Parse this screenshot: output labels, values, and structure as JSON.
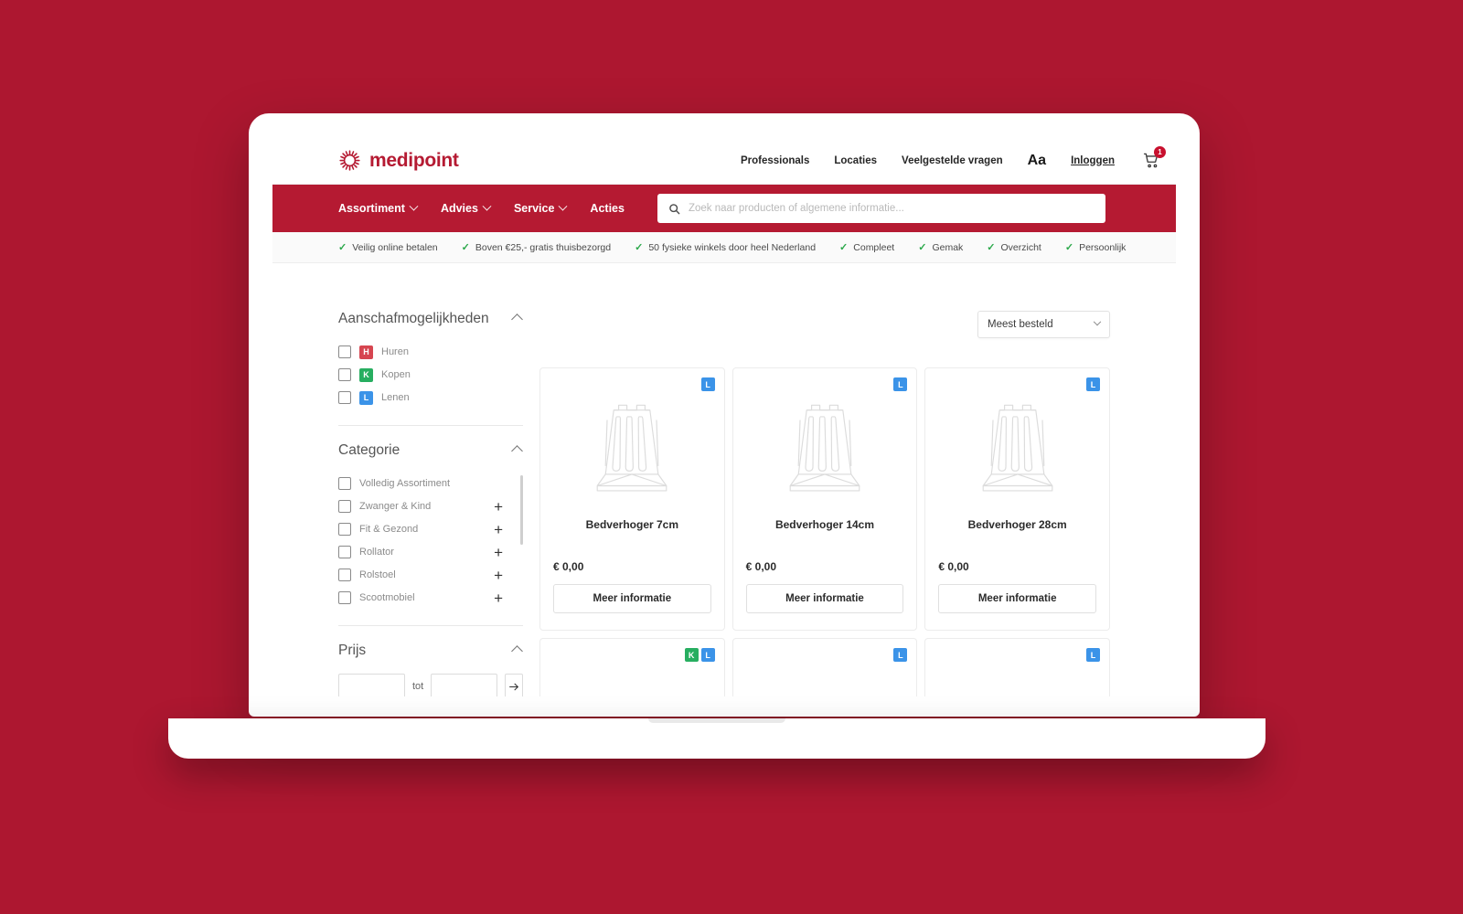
{
  "brand": {
    "name": "medipoint",
    "red": "#B51A32",
    "page_background": "#AD1730"
  },
  "header": {
    "links": [
      {
        "label": "Professionals"
      },
      {
        "label": "Locaties"
      },
      {
        "label": "Veelgestelde vragen"
      }
    ],
    "font_size_toggle": "Aa",
    "login_label": "Inloggen",
    "cart_count": "1"
  },
  "main_nav": {
    "items": [
      {
        "label": "Assortiment",
        "has_dropdown": true
      },
      {
        "label": "Advies",
        "has_dropdown": true
      },
      {
        "label": "Service",
        "has_dropdown": true
      },
      {
        "label": "Acties",
        "has_dropdown": false
      }
    ],
    "search": {
      "placeholder": "Zoek naar producten of algemene informatie...",
      "value": ""
    }
  },
  "usp_bar": {
    "items": [
      {
        "label": "Veilig online betalen"
      },
      {
        "label": "Boven €25,- gratis thuisbezorgd"
      },
      {
        "label": "50 fysieke winkels door heel Nederland"
      },
      {
        "label": "Compleet"
      },
      {
        "label": "Gemak"
      },
      {
        "label": "Overzicht"
      },
      {
        "label": "Persoonlijk"
      }
    ]
  },
  "sidebar": {
    "groups": [
      {
        "title": "Aanschafmogelijkheden",
        "expanded": true,
        "options": [
          {
            "tag": "H",
            "tag_color": "#D64550",
            "label": "Huren",
            "checked": false
          },
          {
            "tag": "K",
            "tag_color": "#27AE60",
            "label": "Kopen",
            "checked": false
          },
          {
            "tag": "L",
            "tag_color": "#3B93E8",
            "label": "Lenen",
            "checked": false
          }
        ]
      },
      {
        "title": "Categorie",
        "expanded": true,
        "options": [
          {
            "label": "Volledig Assortiment",
            "checked": false,
            "expandable": false
          },
          {
            "label": "Zwanger & Kind",
            "checked": false,
            "expandable": true
          },
          {
            "label": "Fit & Gezond",
            "checked": false,
            "expandable": true
          },
          {
            "label": "Rollator",
            "checked": false,
            "expandable": true
          },
          {
            "label": "Rolstoel",
            "checked": false,
            "expandable": true
          },
          {
            "label": "Scootmobiel",
            "checked": false,
            "expandable": true
          }
        ]
      },
      {
        "title": "Prijs",
        "expanded": true,
        "min_value": "",
        "max_value": "",
        "separator_label": "tot",
        "submit_icon": "arrow-right-icon"
      }
    ]
  },
  "products": {
    "sort": {
      "selected": "Meest besteld"
    },
    "items": [
      {
        "title": "Bedverhoger 7cm",
        "price": "€ 0,00",
        "badges": [
          "L"
        ],
        "button": "Meer informatie"
      },
      {
        "title": "Bedverhoger 14cm",
        "price": "€ 0,00",
        "badges": [
          "L"
        ],
        "button": "Meer informatie"
      },
      {
        "title": "Bedverhoger 28cm",
        "price": "€ 0,00",
        "badges": [
          "L"
        ],
        "button": "Meer informatie"
      },
      {
        "title": "",
        "price": "",
        "badges": [
          "K",
          "L"
        ],
        "button": ""
      },
      {
        "title": "",
        "price": "",
        "badges": [
          "L"
        ],
        "button": ""
      },
      {
        "title": "",
        "price": "",
        "badges": [
          "L"
        ],
        "button": ""
      }
    ]
  }
}
